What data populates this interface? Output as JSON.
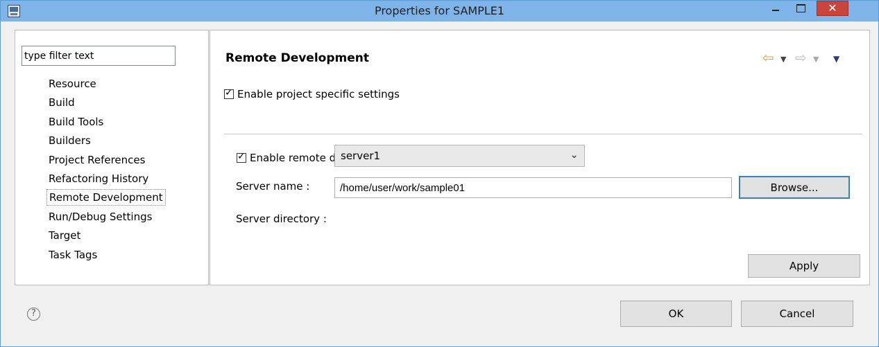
{
  "window": {
    "title": "Properties for SAMPLE1",
    "close_glyph": "✕"
  },
  "sidebar": {
    "filter_value": "type filter text",
    "items": [
      {
        "label": "Resource"
      },
      {
        "label": "Build"
      },
      {
        "label": "Build Tools"
      },
      {
        "label": "Builders"
      },
      {
        "label": "Project References"
      },
      {
        "label": "Refactoring History"
      },
      {
        "label": "Remote Development"
      },
      {
        "label": "Run/Debug Settings"
      },
      {
        "label": "Target"
      },
      {
        "label": "Task Tags"
      }
    ],
    "selected_index": 6
  },
  "page": {
    "title": "Remote Development",
    "enable_project_specific": {
      "label": "Enable project specific settings",
      "checked": true
    },
    "enable_remote": {
      "label": "Enable remote development",
      "checked": true
    },
    "server_name": {
      "label": "Server name :",
      "value": "server1"
    },
    "server_directory": {
      "label": "Server directory :",
      "value": "/home/user/work/sample01"
    },
    "browse_label": "Browse...",
    "apply_label": "Apply"
  },
  "footer": {
    "ok_label": "OK",
    "cancel_label": "Cancel",
    "help_glyph": "?"
  },
  "icons": {
    "back": "back-arrow-icon",
    "forward": "forward-arrow-icon",
    "menu": "view-menu-icon",
    "help": "help-icon"
  },
  "colors": {
    "titlebar": "#7eb4ea",
    "close_button": "#c9463d",
    "focus_border": "#3c7fb1"
  }
}
